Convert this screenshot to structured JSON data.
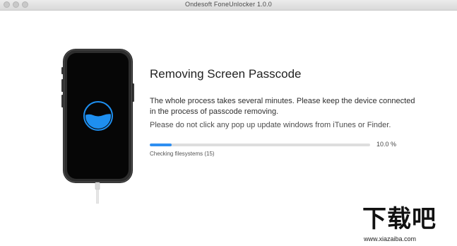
{
  "window": {
    "title": "Ondesoft FoneUnlocker 1.0.0"
  },
  "main": {
    "heading": "Removing Screen Passcode",
    "description": "The whole process takes several minutes. Please keep the device connected in the process of passcode removing.",
    "warning": "Please do not click any pop up update windows from iTunes or Finder.",
    "progress": {
      "percent_label": "10.0 %",
      "fraction": 0.1,
      "status": "Checking filesystems (15)"
    }
  },
  "illustration": {
    "loader_color": "#1e8ff0",
    "phone_color": "#2d2d2d"
  },
  "watermark": {
    "logo": "下载吧",
    "url": "www.xiazaiba.com"
  }
}
